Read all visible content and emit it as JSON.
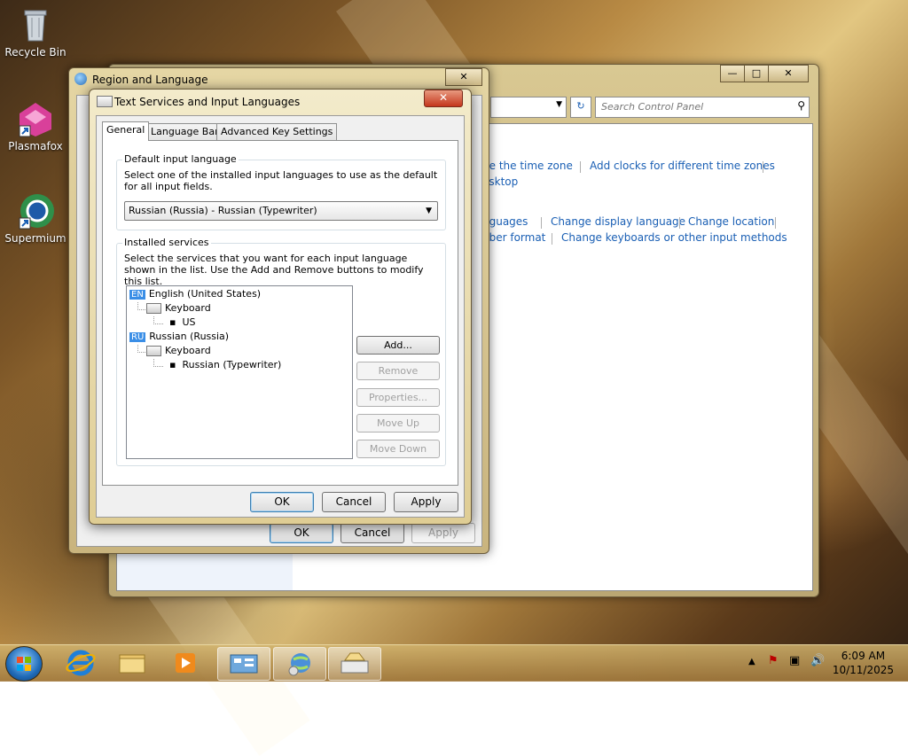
{
  "desktop": {
    "icons": [
      {
        "label": "Recycle Bin"
      },
      {
        "label": "Plasmafox"
      },
      {
        "label": "Supermium"
      }
    ]
  },
  "control_panel": {
    "search_placeholder": "Search Control Panel",
    "links_row1": [
      "ge the time zone",
      "Add clocks for different time zones"
    ],
    "links_row1b": "esktop",
    "links_row2": [
      "nguages",
      "Change display language",
      "Change location"
    ],
    "links_row3": [
      "nber format",
      "Change keyboards or other input methods"
    ]
  },
  "region_dialog": {
    "title": "Region and Language",
    "close": "✕",
    "buttons": {
      "ok": "OK",
      "cancel": "Cancel",
      "apply": "Apply"
    }
  },
  "text_services_dialog": {
    "title": "Text Services and Input Languages",
    "close": "✕",
    "tabs": [
      "General",
      "Language Bar",
      "Advanced Key Settings"
    ],
    "default_input": {
      "group_label": "Default input language",
      "description": "Select one of the installed input languages to use as the default for all input fields.",
      "selected": "Russian (Russia) - Russian (Typewriter)"
    },
    "installed": {
      "group_label": "Installed services",
      "description": "Select the services that you want for each input language shown in the list. Use the Add and Remove buttons to modify this list.",
      "tree": [
        {
          "badge": "EN",
          "label": "English (United States)",
          "category": "Keyboard",
          "item": "US"
        },
        {
          "badge": "RU",
          "label": "Russian (Russia)",
          "category": "Keyboard",
          "item": "Russian (Typewriter)"
        }
      ],
      "buttons": {
        "add": "Add...",
        "remove": "Remove",
        "properties": "Properties...",
        "move_up": "Move Up",
        "move_down": "Move Down"
      }
    },
    "buttons": {
      "ok": "OK",
      "cancel": "Cancel",
      "apply": "Apply"
    }
  },
  "taskbar": {
    "time": "6:09 AM",
    "date": "10/11/2025"
  }
}
